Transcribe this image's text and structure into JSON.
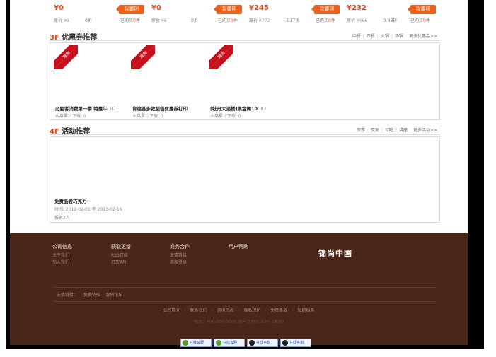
{
  "deals": [
    {
      "price": "¥0",
      "tag": "我要团",
      "orig_label": "原价",
      "orig": "¥0",
      "discount": "0折",
      "bought_pre": "已购买",
      "bought": "0",
      "bought_post": "件"
    },
    {
      "price": "¥0",
      "tag": "我要团",
      "orig_label": "原价",
      "orig": "¥0",
      "discount": "0折",
      "bought_pre": "已购买",
      "bought": "0",
      "bought_post": "件"
    },
    {
      "price": "¥245",
      "tag": "我要团",
      "orig_label": "原价",
      "orig": "¥772",
      "discount": "3.17折",
      "bought_pre": "已购买",
      "bought": "0",
      "bought_post": "件"
    },
    {
      "price": "¥232",
      "tag": "我要团",
      "orig_label": "原价",
      "orig": "¥666",
      "discount": "3.48折",
      "bought_pre": "已购买",
      "bought": "0",
      "bought_post": "件"
    }
  ],
  "coupons_section": {
    "num": "3F",
    "title": " 优惠券推荐",
    "links": [
      "中餐",
      "西餐",
      "火锅",
      "汤锅",
      "更多优惠券>>"
    ],
    "ribbon_text": "减免",
    "items": [
      {
        "title": "必胜客消费第一季 特惠午☐☐",
        "sub": "本券累计下载: 0"
      },
      {
        "title": "肯德基多款超值优惠券打印",
        "sub": "本券累计下载: 0"
      },
      {
        "title": "[牡丹大酒楼]集金阁10☐☐",
        "sub": "本券累计下载: 0"
      }
    ]
  },
  "activity_section": {
    "num": "4F",
    "title": " 活动推荐",
    "links": [
      "旅游",
      "交友",
      "试吃",
      "讲座",
      "更多活动>>"
    ],
    "item": {
      "title": "免费品尝巧克力",
      "date": "时间: 2012-02-01 至 2013-02-16",
      "count": "报名2人"
    }
  },
  "footer": {
    "columns": [
      {
        "head": "公司信息",
        "links": [
          "关于我们",
          "加入我们"
        ]
      },
      {
        "head": "获取更新",
        "links": [
          "RSS订阅",
          "开放API"
        ]
      },
      {
        "head": "商务合作",
        "links": [
          "友情链接",
          "商家登录"
        ]
      },
      {
        "head": "用户帮助",
        "links": []
      }
    ],
    "brand": "锦尚中国",
    "friend_label": "友情链接：",
    "friend_links": [
      "免费VPS",
      "源码论坛"
    ],
    "bottom_links": [
      "公司简介",
      "联系我们",
      "咨询热点",
      "隐私保护",
      "免责条款",
      "加盟服务"
    ],
    "copyright": "电话：400-000-0000 周一至周六 9:00-18:00"
  },
  "badges": [
    "在线客服",
    "在线客服",
    "在线咨询",
    "在线咨询"
  ],
  "colors": {
    "accent": "#e8441a",
    "footer_bg": "#4a2519",
    "ribbon": "#c8101c"
  }
}
